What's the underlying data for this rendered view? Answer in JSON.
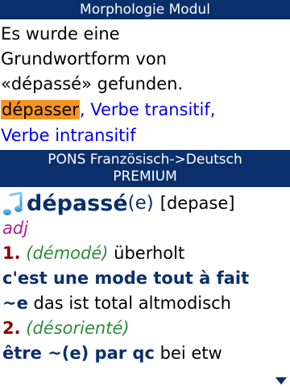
{
  "morph": {
    "title": "Morphologie Modul",
    "line1": "Es wurde eine",
    "line2": "Grundwortform von",
    "line3": "«dépassé» gefunden.",
    "lemma": "dépasser",
    "sep": ",",
    "link1": "Verbe transitif,",
    "link2": "Verbe intransitif"
  },
  "dict": {
    "title_line1": "PONS Französisch->Deutsch",
    "title_line2": "PREMIUM",
    "headword": "dépassé",
    "headword_suffix": "(e)",
    "phonetic": "[depase]",
    "pos": "adj",
    "sense1_num": "1.",
    "sense1_gloss": "(démodé)",
    "sense1_trans": "überholt",
    "example1": "c'est une mode tout à fait",
    "example1b": "~e",
    "example1_trans": "das ist total altmodisch",
    "sense2_num": "2.",
    "sense2_gloss": "(désorienté)",
    "example2": "être ~(e) par qc",
    "example2_trans": "bei etw"
  },
  "icons": {
    "audio": "music-note-icon",
    "scroll": "scroll-down-arrow-icon"
  },
  "colors": {
    "header_bg": "#0a2f6b",
    "highlight": "#f7941e",
    "link": "#0000ee",
    "headword": "#0a2f6b",
    "pos": "#b0208e",
    "sense_number": "#8b0000",
    "gloss": "#2f8a3a"
  }
}
